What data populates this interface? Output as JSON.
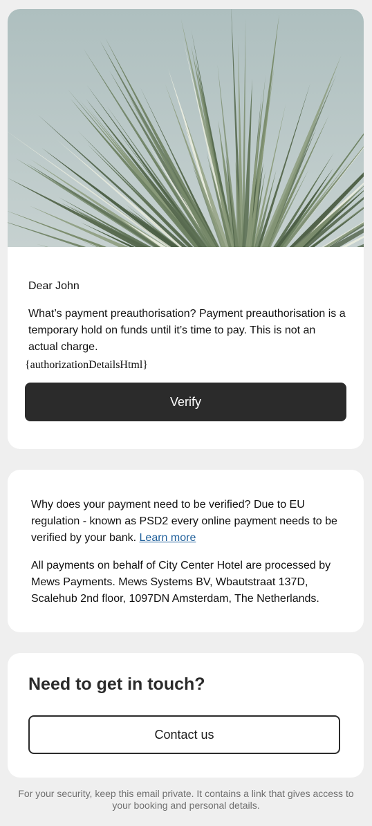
{
  "greeting": "Dear John",
  "intro": "What’s payment preauthorisation? Payment preauthorisation is a temporary hold on funds until it’s time to pay. This is not an actual charge.",
  "template_placeholder": "{authorizationDetailsHtml}",
  "verify_button": "Verify",
  "info": {
    "verification_text": "Why does your payment need to be verified? Due to EU regulation - known as PSD2 every online payment needs to be verified by your bank.",
    "learn_more_link": "Learn more",
    "processor_text": "All payments on behalf of City Center Hotel are processed by Mews Payments. Mews Systems BV, Wbautstraat 137D, Scalehub 2nd floor, 1097DN Amsterdam, The Netherlands."
  },
  "contact": {
    "heading": "Need to get in touch?",
    "button": "Contact us"
  },
  "footer": "For your security, keep this email private. It contains a link that gives access to your booking and personal details.",
  "colors": {
    "page_background": "#efefef",
    "card_background": "#ffffff",
    "primary_button": "#2b2b2b",
    "link": "#1f5f9a",
    "footer_text": "#6f6f6f"
  },
  "icons": {
    "hero_image": "yucca-palm-plant-photo"
  }
}
